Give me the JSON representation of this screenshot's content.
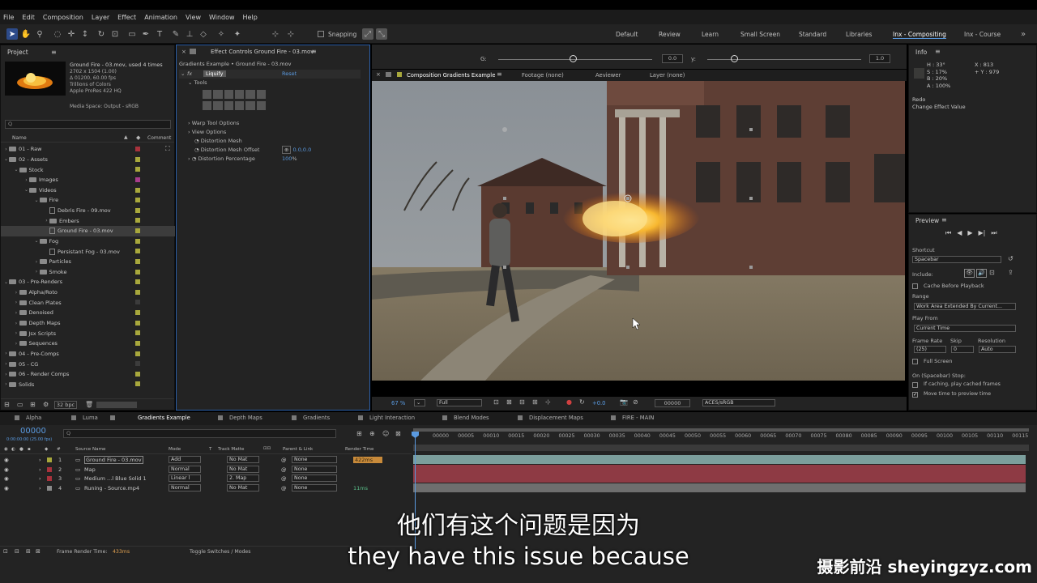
{
  "menu": [
    "File",
    "Edit",
    "Composition",
    "Layer",
    "Effect",
    "Animation",
    "View",
    "Window",
    "Help"
  ],
  "toolbar": {
    "snapping_label": "Snapping"
  },
  "workspaces": [
    "Default",
    "Review",
    "Learn",
    "Small Screen",
    "Standard",
    "Libraries",
    "Inx - Compositing",
    "Inx - Course"
  ],
  "project": {
    "title": "Project",
    "file_name": "Ground Fire - 03.mov",
    "used": ", used 4 times",
    "dims": "2702 x 1504 (1.00)",
    "duration": "Δ 01200, 60.00 fps",
    "colors": "Trillions of Colors",
    "codec": "Apple ProRes 422 HQ",
    "media_space": "Media Space: Output - sRGB",
    "search_placeholder": "Q",
    "col_name": "Name",
    "col_comment": "Comment",
    "items": [
      {
        "label": "01 - Raw",
        "indent": 0,
        "tri": "›",
        "type": "folder",
        "color": "#a8323c"
      },
      {
        "label": "02 - Assets",
        "indent": 0,
        "tri": "⌄",
        "type": "folder",
        "color": "#a8a83c"
      },
      {
        "label": "Stock",
        "indent": 1,
        "tri": "⌄",
        "type": "folder",
        "color": "#a8a83c"
      },
      {
        "label": "Images",
        "indent": 2,
        "tri": "›",
        "type": "folder",
        "color": "#a83c8c"
      },
      {
        "label": "Videos",
        "indent": 2,
        "tri": "⌄",
        "type": "folder",
        "color": "#a8a83c"
      },
      {
        "label": "Fire",
        "indent": 3,
        "tri": "⌄",
        "type": "folder",
        "color": "#a8a83c"
      },
      {
        "label": "Debris Fire - 09.mov",
        "indent": 4,
        "tri": "",
        "type": "file",
        "color": "#a8a83c"
      },
      {
        "label": "Embers",
        "indent": 4,
        "tri": "›",
        "type": "folder",
        "color": "#a8a83c"
      },
      {
        "label": "Ground Fire - 03.mov",
        "indent": 4,
        "tri": "",
        "type": "file",
        "color": "#a8a83c",
        "selected": true
      },
      {
        "label": "Fog",
        "indent": 3,
        "tri": "⌄",
        "type": "folder",
        "color": "#a8a83c"
      },
      {
        "label": "Persistant Fog - 03.mov",
        "indent": 4,
        "tri": "",
        "type": "file",
        "color": "#a8a83c"
      },
      {
        "label": "Particles",
        "indent": 3,
        "tri": "›",
        "type": "folder",
        "color": "#a8a83c"
      },
      {
        "label": "Smoke",
        "indent": 3,
        "tri": "›",
        "type": "folder",
        "color": "#a8a83c"
      },
      {
        "label": "03 - Pre-Renders",
        "indent": 0,
        "tri": "⌄",
        "type": "folder",
        "color": "#a8a83c"
      },
      {
        "label": "Alpha/Roto",
        "indent": 1,
        "tri": "›",
        "type": "folder",
        "color": "#a8a83c"
      },
      {
        "label": "Clean Plates",
        "indent": 1,
        "tri": "›",
        "type": "folder",
        "color": "#3c3c3c"
      },
      {
        "label": "Denoised",
        "indent": 1,
        "tri": "›",
        "type": "folder",
        "color": "#a8a83c"
      },
      {
        "label": "Depth Maps",
        "indent": 1,
        "tri": "›",
        "type": "folder",
        "color": "#a8a83c"
      },
      {
        "label": "Jsx Scripts",
        "indent": 1,
        "tri": "›",
        "type": "folder",
        "color": "#a8a83c"
      },
      {
        "label": "Sequences",
        "indent": 1,
        "tri": "›",
        "type": "folder",
        "color": "#a8a83c"
      },
      {
        "label": "04 - Pre-Comps",
        "indent": 0,
        "tri": "›",
        "type": "folder",
        "color": "#a8a83c"
      },
      {
        "label": "05 - CG",
        "indent": 0,
        "tri": "›",
        "type": "folder",
        "color": "#3c3c3c"
      },
      {
        "label": "06 - Render Comps",
        "indent": 0,
        "tri": "›",
        "type": "folder",
        "color": "#a8a83c"
      },
      {
        "label": "Solids",
        "indent": 0,
        "tri": "›",
        "type": "folder",
        "color": "#a8a83c"
      }
    ],
    "bpc": "32 bpc"
  },
  "effect_controls": {
    "title": "Effect Controls Ground Fire - 03.mov",
    "subtitle": "Gradients Example • Ground Fire - 03.mov",
    "effect_name": "Liquify",
    "reset": "Reset",
    "tools_label": "Tools",
    "warp_tool_options": "Warp Tool Options",
    "view_options": "View Options",
    "distortion_mesh": "Distortion Mesh",
    "distortion_mesh_offset": "Distortion Mesh Offset",
    "offset_value": "0.0,0.0",
    "distortion_percentage": "Distortion Percentage",
    "percentage_value": "100",
    "percentage_unit": "%"
  },
  "gradient_bar": {
    "g_label": "G:",
    "g_value": "0.0",
    "y_label": "y:",
    "y_value": "1.0"
  },
  "comp_tabs": {
    "comp": "Composition Gradients Example",
    "footage": "Footage (none)",
    "aeviewer": "Aeviewer",
    "layer": "Layer (none)"
  },
  "viewer_footer": {
    "zoom": "67",
    "zoom_unit": "%",
    "quality": "Full",
    "exposure": "+0.0",
    "timecode": "00000",
    "colorspace": "ACES/sRGB"
  },
  "info": {
    "title": "Info",
    "h": "H : 33°",
    "s": "S : 17%",
    "b": "B : 20%",
    "a": "A : 100%",
    "x": "X : 813",
    "y": "+ Y : 979",
    "redo": "Redo",
    "change": "Change Effect Value"
  },
  "preview": {
    "title": "Preview",
    "shortcut_label": "Shortcut",
    "shortcut_value": "Spacebar",
    "include_label": "Include:",
    "cache_label": "Cache Before Playback",
    "range_label": "Range",
    "range_value": "Work Area Extended By Current...",
    "play_from_label": "Play From",
    "play_from_value": "Current Time",
    "frame_rate_label": "Frame Rate",
    "skip_label": "Skip",
    "resolution_label": "Resolution",
    "frame_rate_value": "(25)",
    "skip_value": "0",
    "resolution_value": "Auto",
    "full_screen": "Full Screen",
    "on_stop": "On (Spacebar) Stop:",
    "if_caching": "If caching, play cached frames",
    "move_time": "Move time to preview time"
  },
  "timeline": {
    "tabs": [
      "Alpha",
      "Luma",
      "Gradients Example",
      "Depth Maps",
      "Gradients",
      "Light Interaction",
      "Blend Modes",
      "Displacement Maps",
      "FIRE - MAIN"
    ],
    "active_tab": "Gradients Example",
    "timecode": "00000",
    "timecode_sub": "0:00:00:00 (25.00 fps)",
    "search_placeholder": "Q",
    "cols": {
      "source": "Source Name",
      "mode": "Mode",
      "t": "T",
      "track": "Track Matte",
      "parent": "Parent & Link",
      "render": "Render Time"
    },
    "layers": [
      {
        "num": "1",
        "name": "Ground Fire - 03.mov",
        "mode": "Add",
        "track": "No Mat",
        "parent": "None",
        "render": "422ms",
        "color": "#a8a83c",
        "selected": true
      },
      {
        "num": "2",
        "name": "Map",
        "mode": "Normal",
        "track": "No Mat",
        "parent": "None",
        "render": "",
        "color": "#a8323c"
      },
      {
        "num": "3",
        "name": "Medium ...l Blue Solid 1",
        "mode": "Linear l",
        "track": "2. Map",
        "parent": "None",
        "render": "",
        "color": "#a8323c"
      },
      {
        "num": "4",
        "name": "Runing - Source.mp4",
        "mode": "Normal",
        "track": "No Mat",
        "parent": "None",
        "render": "11ms",
        "color": "#8a8a8a"
      }
    ],
    "ruler": [
      "00000",
      "00005",
      "00010",
      "00015",
      "00020",
      "00025",
      "00030",
      "00035",
      "00040",
      "00045",
      "00050",
      "00055",
      "00060",
      "00065",
      "00070",
      "00075",
      "00080",
      "00085",
      "00090",
      "00095",
      "00100",
      "00105",
      "00110",
      "00115",
      "00120"
    ],
    "frame_render_label": "Frame Render Time:",
    "frame_render_value": "433ms",
    "toggle": "Toggle Switches / Modes"
  },
  "subtitles": {
    "cn": "他们有这个问题是因为",
    "en": "they have this issue because"
  },
  "watermark": "摄影前沿 sheyingzyz.com"
}
